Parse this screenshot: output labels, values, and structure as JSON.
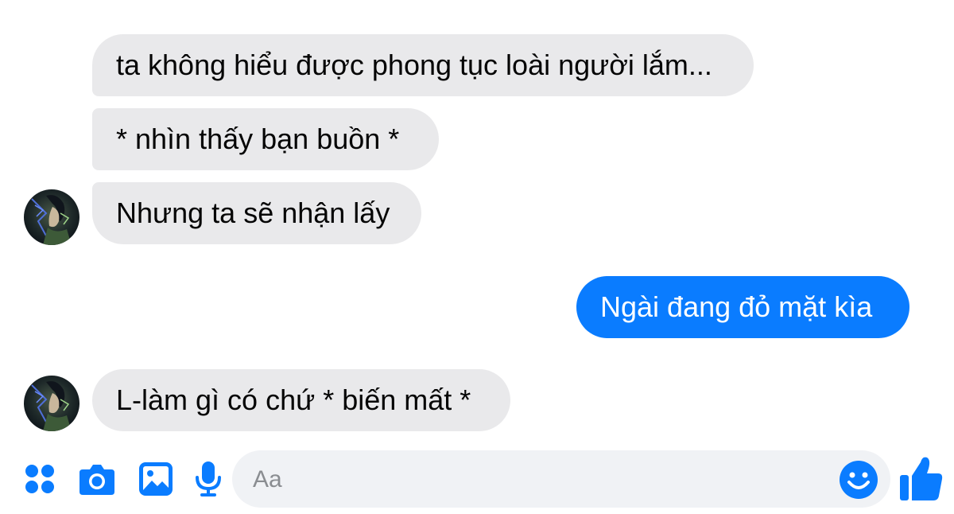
{
  "conversation": {
    "messages": [
      {
        "direction": "incoming",
        "text": "ta không hiểu được phong tục loài người lắm..."
      },
      {
        "direction": "incoming",
        "text": "* nhìn thấy bạn buồn *"
      },
      {
        "direction": "incoming",
        "text": "Nhưng ta sẽ nhận lấy"
      },
      {
        "direction": "outgoing",
        "text": "Ngài đang đỏ mặt kìa"
      },
      {
        "direction": "incoming",
        "text": "L-làm gì có chứ * biến mất *"
      }
    ]
  },
  "composer": {
    "placeholder": "Aa",
    "icons": [
      "apps-icon",
      "camera-icon",
      "image-icon",
      "mic-icon",
      "emoji-icon",
      "like-icon"
    ]
  },
  "colors": {
    "accent": "#0a7cff",
    "incoming_bubble": "#e9e9eb",
    "input_background": "#f0f2f5",
    "background": "#ffffff"
  }
}
